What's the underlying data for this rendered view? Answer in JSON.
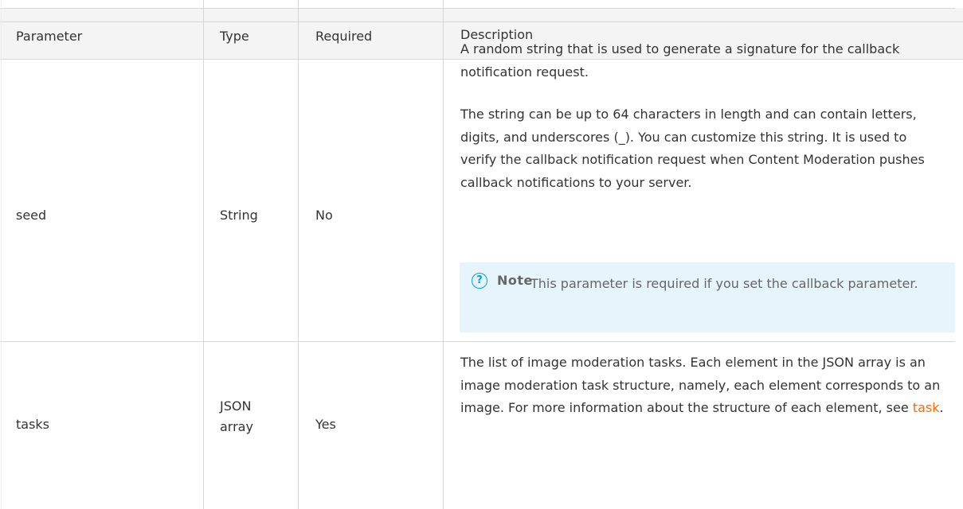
{
  "table": {
    "headers": [
      "Parameter",
      "Type",
      "Required",
      "Description"
    ],
    "rows": [
      {
        "parameter": "seed",
        "type": "String",
        "required": "No",
        "description_paragraphs": [
          "A random string that is used to generate a signature for the callback notification request.",
          "The string can be up to 64 characters in length and can contain letters, digits, and underscores (_). You can customize this string. It is used to verify the callback notification request when Content Moderation pushes callback notifications to your server."
        ],
        "note": {
          "icon": "question-circle-icon",
          "title": "Note",
          "text": "This parameter is required if you set the callback parameter."
        }
      },
      {
        "parameter": "tasks",
        "type_line1": "JSON",
        "type_line2": "array",
        "required": "Yes",
        "description": "The list of image moderation tasks. Each element in the JSON array is an image moderation task structure, namely, each element corresponds to an image. For more information about the structure of each element, see",
        "link_text": "task",
        "description_end": "."
      }
    ]
  },
  "colors": {
    "header_bg": "#f4f4f4",
    "border": "#d6d6d6",
    "text": "#333333",
    "note_bg": "#e6f4fc",
    "note_icon": "#00a0e8",
    "link": "#ff6a00"
  }
}
